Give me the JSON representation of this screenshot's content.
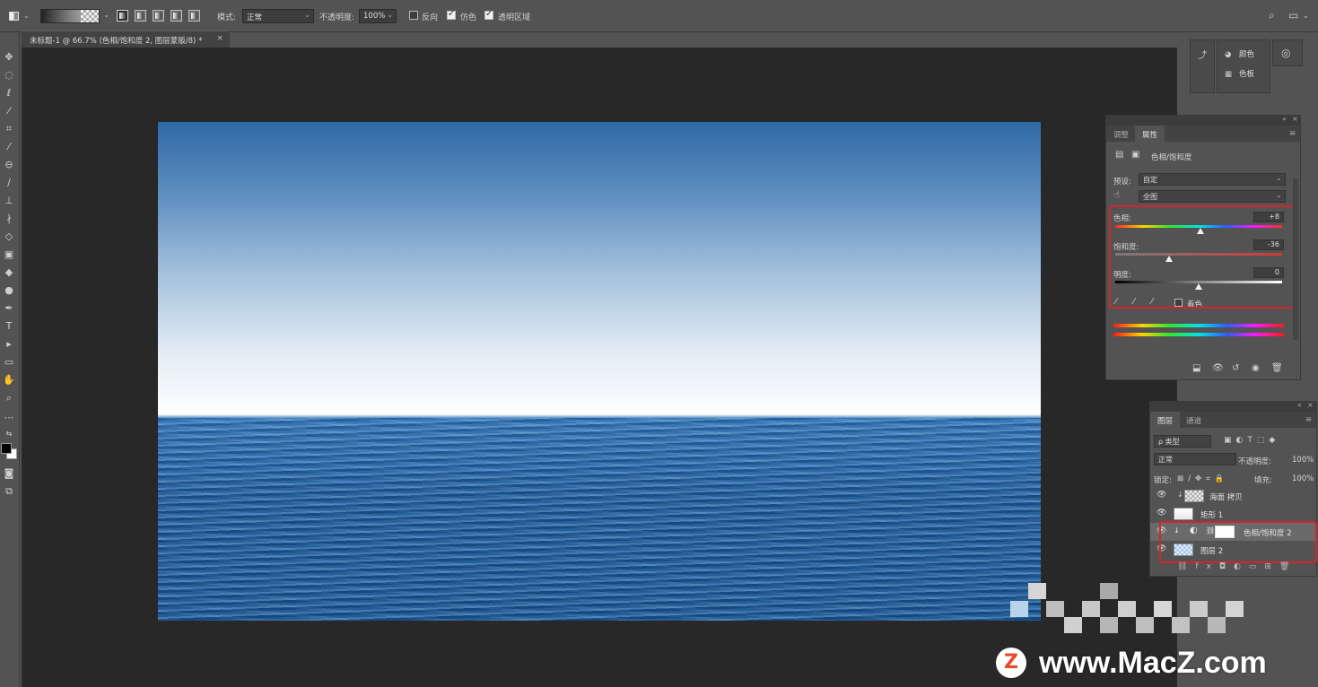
{
  "options_bar": {
    "mode_label": "模式:",
    "mode_value": "正常",
    "opacity_label": "不透明度:",
    "opacity_value": "100%",
    "reverse_label": "反向",
    "dither_label": "仿色",
    "transparency_label": "透明区域",
    "reverse_checked": false,
    "dither_checked": true,
    "transparency_checked": true
  },
  "document_tab": {
    "title": "未标题-1 @ 66.7% (色相/饱和度 2, 图层蒙版/8) *",
    "close": "×"
  },
  "collapsed_panels": {
    "color_label": "颜色",
    "swatches_label": "色板"
  },
  "properties": {
    "tab_adjust": "调整",
    "tab_properties": "属性",
    "title": "色相/饱和度",
    "preset_label": "预设:",
    "preset_value": "自定",
    "range_value": "全图",
    "hue_label": "色相:",
    "hue_value": "+8",
    "hue_level": 0.511,
    "saturation_label": "饱和度:",
    "saturation_value": "-36",
    "saturation_level": 0.32,
    "lightness_label": "明度:",
    "lightness_value": "0",
    "lightness_level": 0.5,
    "colorize_label": "着色",
    "colorize_checked": false
  },
  "layers": {
    "tab_layers": "图层",
    "tab_channels": "通道",
    "filter_value": "ρ 类型",
    "blend_mode": "正常",
    "opacity_label": "不透明度:",
    "opacity_value": "100%",
    "lock_label": "锁定:",
    "fill_label": "填充:",
    "fill_value": "100%",
    "items": [
      {
        "name": "海面 拷贝"
      },
      {
        "name": "矩形 1"
      },
      {
        "name": "色相/饱和度 2"
      },
      {
        "name": "图层 2"
      }
    ]
  },
  "watermark": {
    "logo": "Z",
    "text": "www.MacZ.com"
  },
  "colors": {
    "ui_bg": "#535353",
    "workspace": "#282828",
    "highlight_red": "#d0252d"
  }
}
